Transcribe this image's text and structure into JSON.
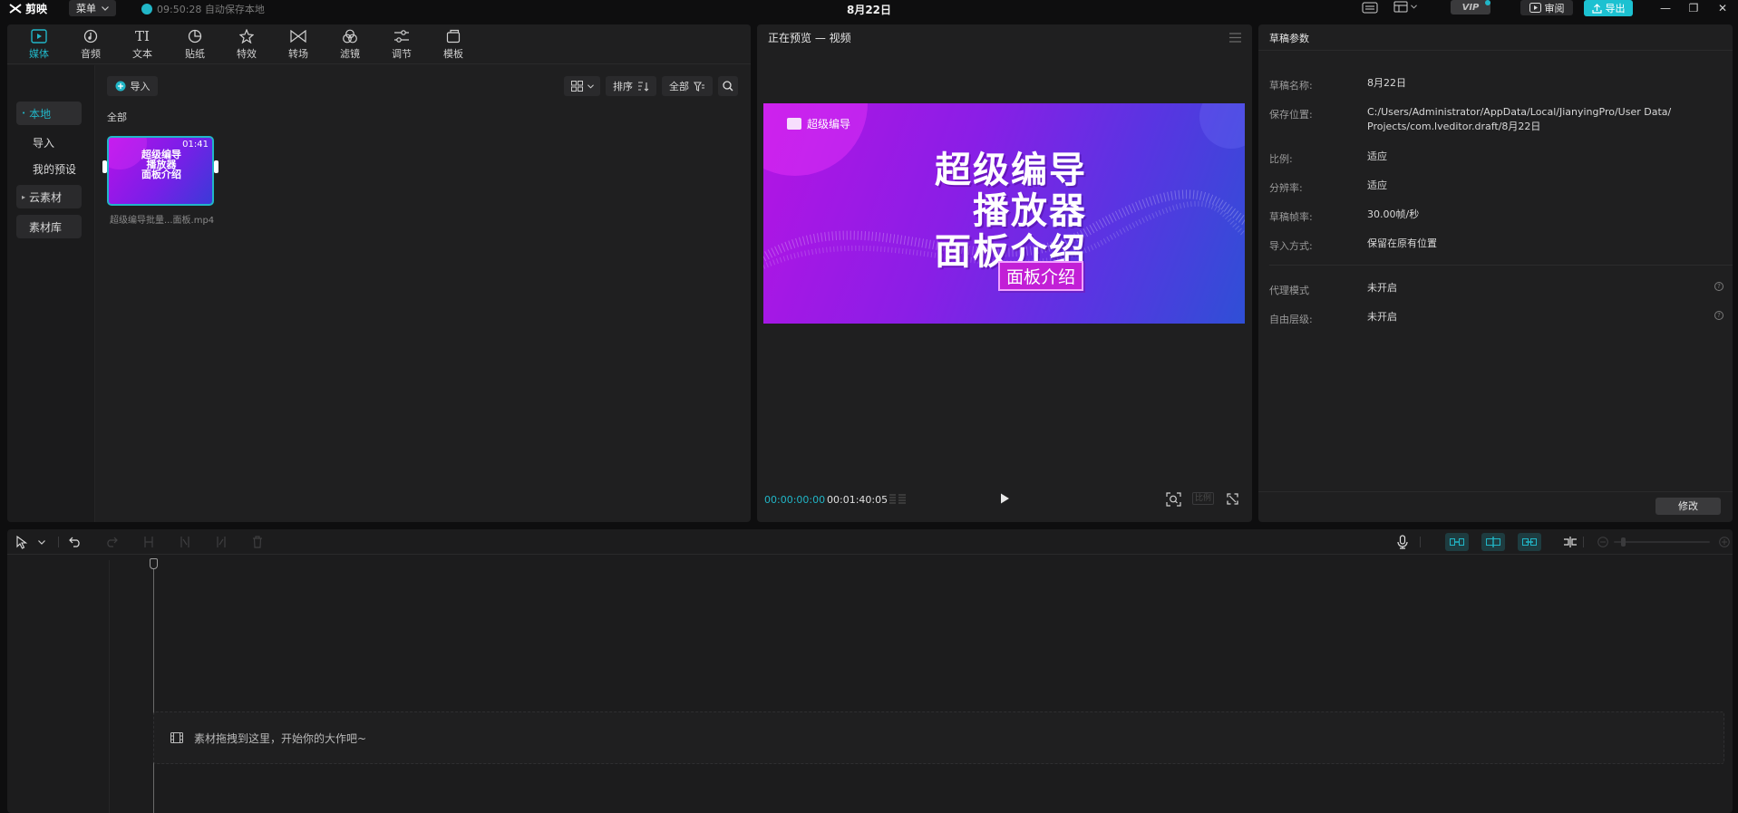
{
  "app": {
    "logo": "剪映",
    "menu_label": "菜单",
    "autosave_text": "09:50:28 自动保存本地",
    "title": "8月22日",
    "vip_label": "VIP",
    "review_label": "审阅",
    "export_label": "导出"
  },
  "media_tabs": [
    {
      "label": "媒体",
      "icon": "media-icon",
      "active": true
    },
    {
      "label": "音频",
      "icon": "audio-icon"
    },
    {
      "label": "文本",
      "icon": "text-icon"
    },
    {
      "label": "贴纸",
      "icon": "sticker-icon"
    },
    {
      "label": "特效",
      "icon": "effects-icon"
    },
    {
      "label": "转场",
      "icon": "transition-icon"
    },
    {
      "label": "滤镜",
      "icon": "filter-icon"
    },
    {
      "label": "调节",
      "icon": "adjust-icon"
    },
    {
      "label": "模板",
      "icon": "template-icon"
    }
  ],
  "media_sidebar": {
    "local": "本地",
    "import": "导入",
    "my_presets": "我的预设",
    "cloud": "云素材",
    "library": "素材库"
  },
  "media_toolbar": {
    "import_label": "导入",
    "sort_label": "排序",
    "filter_label": "全部"
  },
  "media_content": {
    "section_label": "全部",
    "clip": {
      "duration": "01:41",
      "title_lines": [
        "超级编导",
        "播放器",
        "面板介绍"
      ],
      "filename": "超级编导批量...面板.mp4"
    }
  },
  "preview": {
    "header": "正在预览 — 视频",
    "brand": "超级编导",
    "big_text": [
      "超级编导",
      "播放器",
      "面板介绍"
    ],
    "tag_text": "面板介绍",
    "current_time": "00:00:00:00",
    "total_time": "00:01:40:05",
    "ratio_label": "比例"
  },
  "props": {
    "header": "草稿参数",
    "name_label": "草稿名称:",
    "name_value": "8月22日",
    "path_label": "保存位置:",
    "path_line1": "C:/Users/Administrator/AppData/Local/JianyingPro/User Data/",
    "path_line2": "Projects/com.lveditor.draft/8月22日",
    "ratio_label": "比例:",
    "ratio_value": "适应",
    "resolution_label": "分辨率:",
    "resolution_value": "适应",
    "fps_label": "草稿帧率:",
    "fps_value": "30.00帧/秒",
    "import_mode_label": "导入方式:",
    "import_mode_value": "保留在原有位置",
    "proxy_label": "代理模式",
    "proxy_value": "未开启",
    "layer_label": "自由层级:",
    "layer_value": "未开启",
    "modify_label": "修改"
  },
  "timeline": {
    "drop_hint": "素材拖拽到这里，开始你的大作吧~"
  },
  "colors": {
    "accent": "#21b6c7",
    "panel": "#1f1f20",
    "background": "#0e0e0f"
  }
}
